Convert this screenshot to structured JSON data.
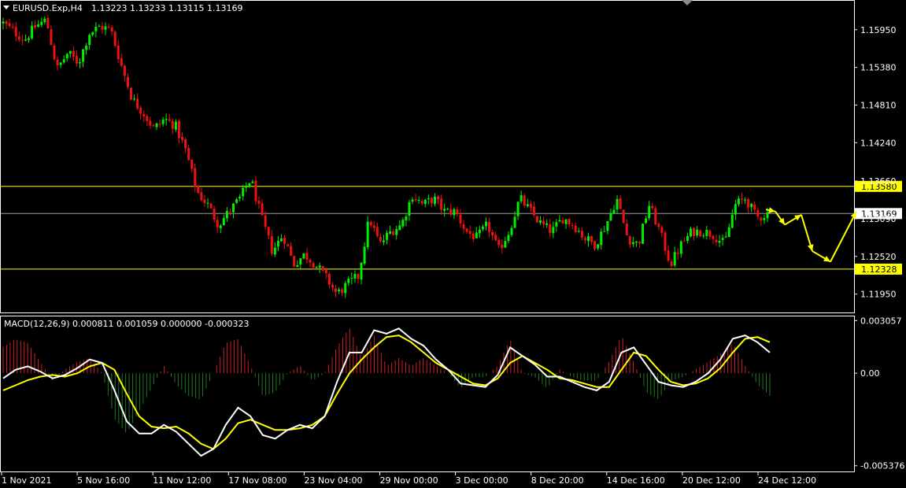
{
  "header": {
    "symbol": "EURUSD.Exp,H4",
    "ohlc": "1.13223 1.13233 1.13115 1.13169"
  },
  "macd_header": "MACD(12,26,9) 0.000811 0.001059 0.000000 -0.000323",
  "colors": {
    "bull": "#00ee00",
    "bear": "#ee1111",
    "level": "#ffff00",
    "current": "#9a9a9a",
    "macd": "#ffffff",
    "signal": "#ffff00",
    "hist_pos": "#cc2222",
    "hist_neg": "#1f7a1f",
    "frame": "#ffffff"
  },
  "chart_data": [
    {
      "type": "candlestick",
      "price_ticks": [
        "1.15950",
        "1.15380",
        "1.14810",
        "1.14240",
        "1.13660",
        "1.13090",
        "1.12520",
        "1.11950"
      ],
      "ylim": [
        1.1166,
        1.164
      ],
      "levels": [
        {
          "value": 1.1358,
          "label": "1.13580"
        },
        {
          "value": 1.12328,
          "label": "1.12328"
        }
      ],
      "current_price": {
        "value": 1.13169,
        "label": "1.13169"
      },
      "time_labels": [
        "1 Nov 2021",
        "5 Nov 16:00",
        "11 Nov 12:00",
        "17 Nov 08:00",
        "23 Nov 04:00",
        "29 Nov 00:00",
        "3 Dec 00:00",
        "8 Dec 20:00",
        "14 Dec 16:00",
        "20 Dec 12:00",
        "24 Dec 12:00"
      ],
      "close_path": [
        1.1605,
        1.1592,
        1.158,
        1.16,
        1.161,
        1.1535,
        1.156,
        1.1545,
        1.159,
        1.16,
        1.1595,
        1.154,
        1.149,
        1.147,
        1.1445,
        1.146,
        1.145,
        1.141,
        1.135,
        1.133,
        1.13,
        1.132,
        1.134,
        1.137,
        1.131,
        1.126,
        1.1285,
        1.124,
        1.1255,
        1.124,
        1.122,
        1.1195,
        1.121,
        1.1222,
        1.131,
        1.127,
        1.129,
        1.13,
        1.1345,
        1.133,
        1.134,
        1.132,
        1.132,
        1.129,
        1.128,
        1.13,
        1.126,
        1.129,
        1.134,
        1.132,
        1.13,
        1.129,
        1.131,
        1.13,
        1.128,
        1.127,
        1.13,
        1.134,
        1.128,
        1.127,
        1.133,
        1.129,
        1.124,
        1.127,
        1.129,
        1.129,
        1.1285,
        1.127,
        1.133,
        1.134,
        1.131,
        1.1317
      ],
      "projection": [
        {
          "x": 973,
          "price": 1.1323
        },
        {
          "x": 985,
          "price": 1.132
        },
        {
          "x": 997,
          "price": 1.13
        },
        {
          "x": 1018,
          "price": 1.1315
        },
        {
          "x": 1032,
          "price": 1.126
        },
        {
          "x": 1055,
          "price": 1.1244
        },
        {
          "x": 1088,
          "price": 1.132
        }
      ]
    },
    {
      "type": "line",
      "name": "MACD(12,26,9)",
      "ticks": [
        "0.003057",
        "0.00",
        "-0.005376"
      ],
      "ylim": [
        -0.0058,
        0.0033
      ],
      "macd": [
        -0.0003,
        0.0002,
        0.0004,
        0.0001,
        -0.0003,
        -0.0001,
        0.0003,
        0.0008,
        0.0006,
        -0.001,
        -0.0028,
        -0.0035,
        -0.0035,
        -0.003,
        -0.0034,
        -0.0041,
        -0.0048,
        -0.0044,
        -0.003,
        -0.002,
        -0.0025,
        -0.0036,
        -0.0038,
        -0.0033,
        -0.003,
        -0.0032,
        -0.0025,
        -0.0005,
        0.0012,
        0.0012,
        0.0025,
        0.0023,
        0.0026,
        0.002,
        0.0016,
        0.0008,
        0.0002,
        -0.0006,
        -0.0007,
        -0.0008,
        -0.0001,
        0.0015,
        0.001,
        0.0005,
        -0.0002,
        -0.0002,
        -0.0005,
        -0.0008,
        -0.001,
        -0.0005,
        0.0012,
        0.0015,
        0.0005,
        -0.0005,
        -0.0007,
        -0.0008,
        -0.0005,
        0.0,
        0.0008,
        0.002,
        0.0022,
        0.0018,
        0.0012
      ],
      "signal": [
        -0.001,
        -0.0007,
        -0.0004,
        -0.0002,
        -0.0001,
        -0.0002,
        0.0,
        0.0004,
        0.0006,
        0.0002,
        -0.0012,
        -0.0025,
        -0.0031,
        -0.0032,
        -0.0031,
        -0.0035,
        -0.0041,
        -0.0044,
        -0.0038,
        -0.0029,
        -0.0027,
        -0.003,
        -0.0033,
        -0.0033,
        -0.0032,
        -0.003,
        -0.0025,
        -0.0012,
        0.0,
        0.0008,
        0.0015,
        0.0021,
        0.0022,
        0.0018,
        0.0012,
        0.0006,
        0.0002,
        -0.0002,
        -0.0006,
        -0.0007,
        -0.0003,
        0.0006,
        0.001,
        0.0006,
        0.0002,
        -0.0003,
        -0.0004,
        -0.0006,
        -0.0008,
        -0.0008,
        0.0002,
        0.0012,
        0.001,
        0.0002,
        -0.0005,
        -0.0007,
        -0.0006,
        -0.0003,
        0.0003,
        0.0012,
        0.002,
        0.0021,
        0.0018
      ]
    }
  ]
}
